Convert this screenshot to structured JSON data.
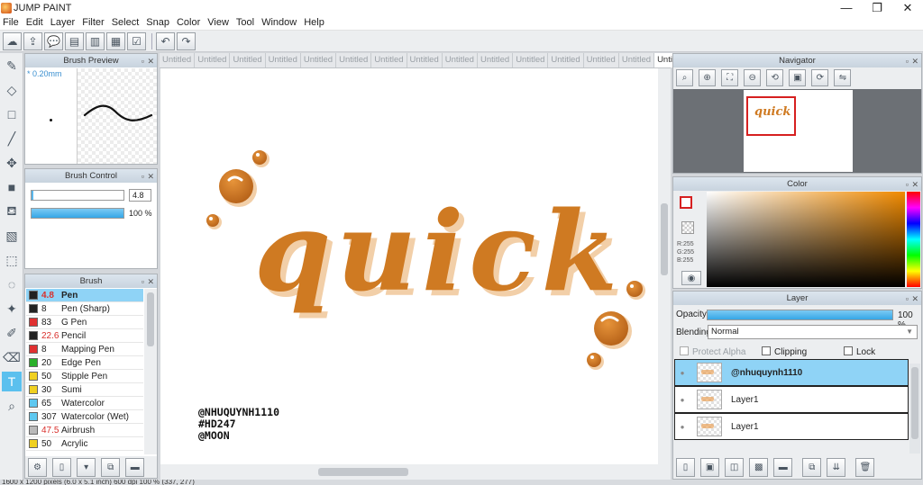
{
  "window": {
    "title": "JUMP PAINT",
    "minimize": "—",
    "restore": "❐",
    "close": "✕"
  },
  "menu": [
    "File",
    "Edit",
    "Layer",
    "Filter",
    "Select",
    "Snap",
    "Color",
    "View",
    "Tool",
    "Window",
    "Help"
  ],
  "tabs": [
    "Untitled",
    "Untitled",
    "Untitled",
    "Untitled",
    "Untitled",
    "Untitled",
    "Untitled",
    "Untitled",
    "Untitled",
    "Untitled",
    "Untitled",
    "Untitled",
    "Untitled",
    "Untitled",
    "Untitled"
  ],
  "brush_preview": {
    "title": "Brush Preview",
    "size_label": "* 0.20mm"
  },
  "brush_control": {
    "title": "Brush Control",
    "size_value": "4.8",
    "opacity_value": "100 %",
    "opacity_fraction": 1.0,
    "size_fraction": 0.02
  },
  "brush_panel": {
    "title": "Brush",
    "items": [
      {
        "size": "4.8",
        "name": "Pen",
        "color": "#222222",
        "selected": true,
        "red": true
      },
      {
        "size": "8",
        "name": "Pen (Sharp)",
        "color": "#222222"
      },
      {
        "size": "83",
        "name": "G Pen",
        "color": "#e03030"
      },
      {
        "size": "22.6",
        "name": "Pencil",
        "color": "#222222",
        "red": true
      },
      {
        "size": "8",
        "name": "Mapping Pen",
        "color": "#e03030"
      },
      {
        "size": "20",
        "name": "Edge Pen",
        "color": "#2ab02a"
      },
      {
        "size": "50",
        "name": "Stipple Pen",
        "color": "#f0d020"
      },
      {
        "size": "30",
        "name": "Sumi",
        "color": "#f0d020"
      },
      {
        "size": "65",
        "name": "Watercolor",
        "color": "#5ec8f0"
      },
      {
        "size": "307",
        "name": "Watercolor (Wet)",
        "color": "#5ec8f0"
      },
      {
        "size": "47.5",
        "name": "Airbrush",
        "color": "#b9b9b9",
        "red": true
      },
      {
        "size": "50",
        "name": "Acrylic",
        "color": "#f0d020"
      }
    ]
  },
  "canvas": {
    "lettering": "quick",
    "credits": [
      "@NHUQUYNH1110",
      "#HD247",
      "@MOON"
    ],
    "accent": "#cf7a22"
  },
  "navigator": {
    "title": "Navigator",
    "preview_text": "quick"
  },
  "color_panel": {
    "title": "Color",
    "r": "R:255",
    "g": "G:255",
    "b": "B:255"
  },
  "layer_panel": {
    "title": "Layer",
    "opacity_label": "Opacity",
    "opacity_value": "100 %",
    "opacity_fraction": 1.0,
    "blending_label": "Blending",
    "blending_value": "Normal",
    "protect_alpha": "Protect Alpha",
    "clipping": "Clipping",
    "lock": "Lock",
    "layers": [
      {
        "name": "@nhuquynh1110",
        "selected": true
      },
      {
        "name": "Layer1"
      },
      {
        "name": "Layer1"
      }
    ]
  },
  "status": "1600 x 1200 pixels (6.0 x 5.1 inch)  600 dpi  100 %  (337, 277)"
}
